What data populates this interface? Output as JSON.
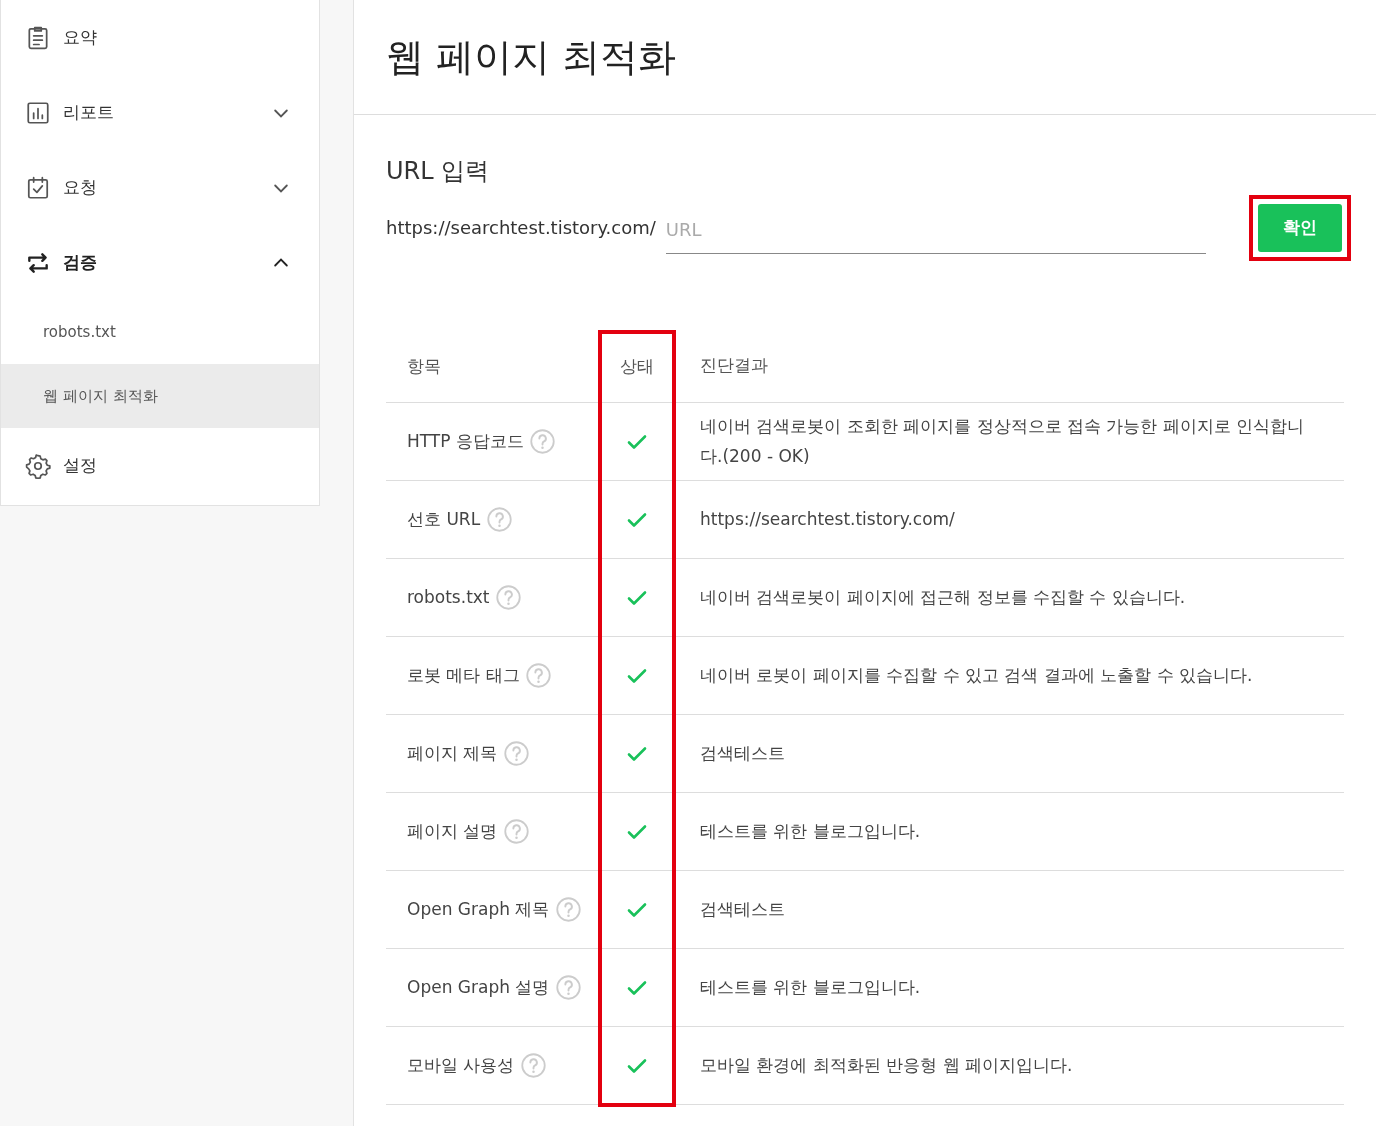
{
  "sidebar": {
    "items": [
      {
        "label": "요약"
      },
      {
        "label": "리포트",
        "expanded": false
      },
      {
        "label": "요청",
        "expanded": false
      },
      {
        "label": "검증",
        "expanded": true,
        "children": [
          {
            "label": "robots.txt",
            "selected": false
          },
          {
            "label": "웹 페이지 최적화",
            "selected": true
          }
        ]
      },
      {
        "label": "설정"
      }
    ]
  },
  "page": {
    "title": "웹 페이지 최적화"
  },
  "url_section": {
    "heading": "URL 입력",
    "prefix": "https://searchtest.tistory.com/",
    "placeholder": "URL",
    "button": {
      "label": "확인",
      "highlighted": true
    }
  },
  "table": {
    "columns": [
      {
        "label": "항목",
        "highlighted": false
      },
      {
        "label": "상태",
        "highlighted": true
      },
      {
        "label": "진단결과",
        "highlighted": false
      }
    ],
    "rows": [
      {
        "item": "HTTP 응답코드",
        "help": true,
        "passed": true,
        "result": "네이버 검색로봇이 조회한 페이지를 정상적으로 접속 가능한 페이지로 인식합니다.(200 - OK)"
      },
      {
        "item": "선호 URL",
        "help": true,
        "passed": true,
        "result": "https://searchtest.tistory.com/"
      },
      {
        "item": "robots.txt",
        "help": true,
        "passed": true,
        "result": "네이버 검색로봇이 페이지에 접근해 정보를 수집할 수 있습니다."
      },
      {
        "item": "로봇 메타 태그",
        "help": true,
        "passed": true,
        "result": "네이버 로봇이 페이지를 수집할 수 있고 검색 결과에 노출할 수 있습니다."
      },
      {
        "item": "페이지 제목",
        "help": true,
        "passed": true,
        "result": "검색테스트"
      },
      {
        "item": "페이지 설명",
        "help": true,
        "passed": true,
        "result": "테스트를 위한 블로그입니다."
      },
      {
        "item": "Open Graph 제목",
        "help": true,
        "passed": true,
        "result": "검색테스트"
      },
      {
        "item": "Open Graph 설명",
        "help": true,
        "passed": true,
        "result": "테스트를 위한 블로그입니다."
      },
      {
        "item": "모바일 사용성",
        "help": true,
        "passed": true,
        "result": "모바일 환경에 최적화된 반응형 웹 페이지입니다."
      }
    ]
  }
}
